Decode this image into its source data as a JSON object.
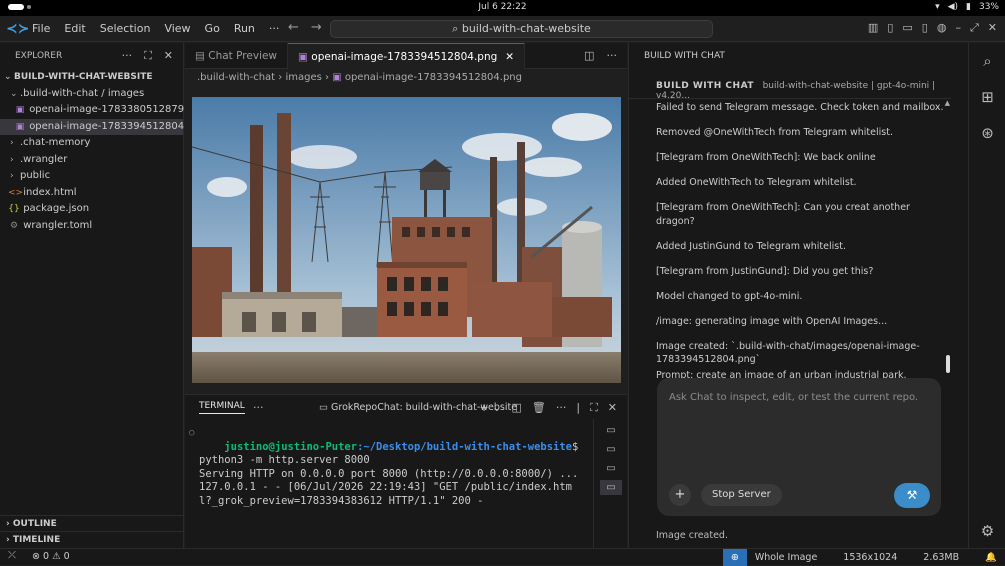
{
  "system": {
    "clock": "Jul 6  22:22",
    "battery": "33%"
  },
  "titlebar": {
    "menu": [
      "File",
      "Edit",
      "Selection",
      "View",
      "Go",
      "Run",
      "···"
    ],
    "search_text": "build-with-chat-website"
  },
  "explorer": {
    "header": "EXPLORER",
    "root": "BUILD-WITH-CHAT-WEBSITE",
    "folder_open": ".build-with-chat / images",
    "files_in_images": [
      "openai-image-1783380512879.png",
      "openai-image-1783394512804.png"
    ],
    "folders": [
      ".chat-memory",
      ".wrangler",
      "public"
    ],
    "files": [
      "index.html",
      "package.json",
      "wrangler.toml"
    ],
    "outline": "OUTLINE",
    "timeline": "TIMELINE"
  },
  "editor": {
    "tabs": [
      {
        "label": "Chat Preview"
      },
      {
        "label": "openai-image-1783394512804.png"
      }
    ],
    "breadcrumb": [
      ".build-with-chat",
      "images",
      "openai-image-1783394512804.png"
    ]
  },
  "panel": {
    "tab": "TERMINAL",
    "terminal_name": "GrokRepoChat: build-with-chat-website",
    "prompt_user": "justino@justino-Puter",
    "prompt_path": ":~/Desktop/build-with-chat-website",
    "prompt_cmd": "$ python3 -m http.server 8000",
    "output_lines": [
      "Serving HTTP on 0.0.0.0 port 8000 (http://0.0.0.0:8000/) ...",
      "127.0.0.1 - - [06/Jul/2026 22:19:43] \"GET /public/index.html?_grok_preview=1783394383612 HTTP/1.1\" 200 -"
    ]
  },
  "chat": {
    "panel_title": "BUILD WITH CHAT",
    "header_title": "BUILD WITH CHAT",
    "header_sub": "build-with-chat-website | gpt-4o-mini | v4.20...",
    "messages": [
      "Failed to send Telegram message. Check token and mailbox.",
      "Removed @OneWithTech from Telegram whitelist.",
      "[Telegram from OneWithTech]: We back online",
      "Added OneWithTech to Telegram whitelist.",
      "[Telegram from OneWithTech]: Can you creat another dragon?",
      "Added JustinGund to Telegram whitelist.",
      "[Telegram from JustinGund]: Did you get this?",
      "Model changed to gpt-4o-mini.",
      "/image: generating image with OpenAI Images...",
      "Image created: `.build-with-chat/images/openai-image-1783394512804.png`",
      "Prompt: create an image of an urban industrial park."
    ],
    "input_placeholder": "Ask Chat to inspect, edit, or test the current repo.",
    "stop_label": "Stop Server",
    "status": "Image created."
  },
  "statusbar": {
    "errors": "0",
    "warnings": "0",
    "zoom_label": "Whole Image",
    "dimensions": "1536x1024",
    "size": "2.63MB"
  }
}
